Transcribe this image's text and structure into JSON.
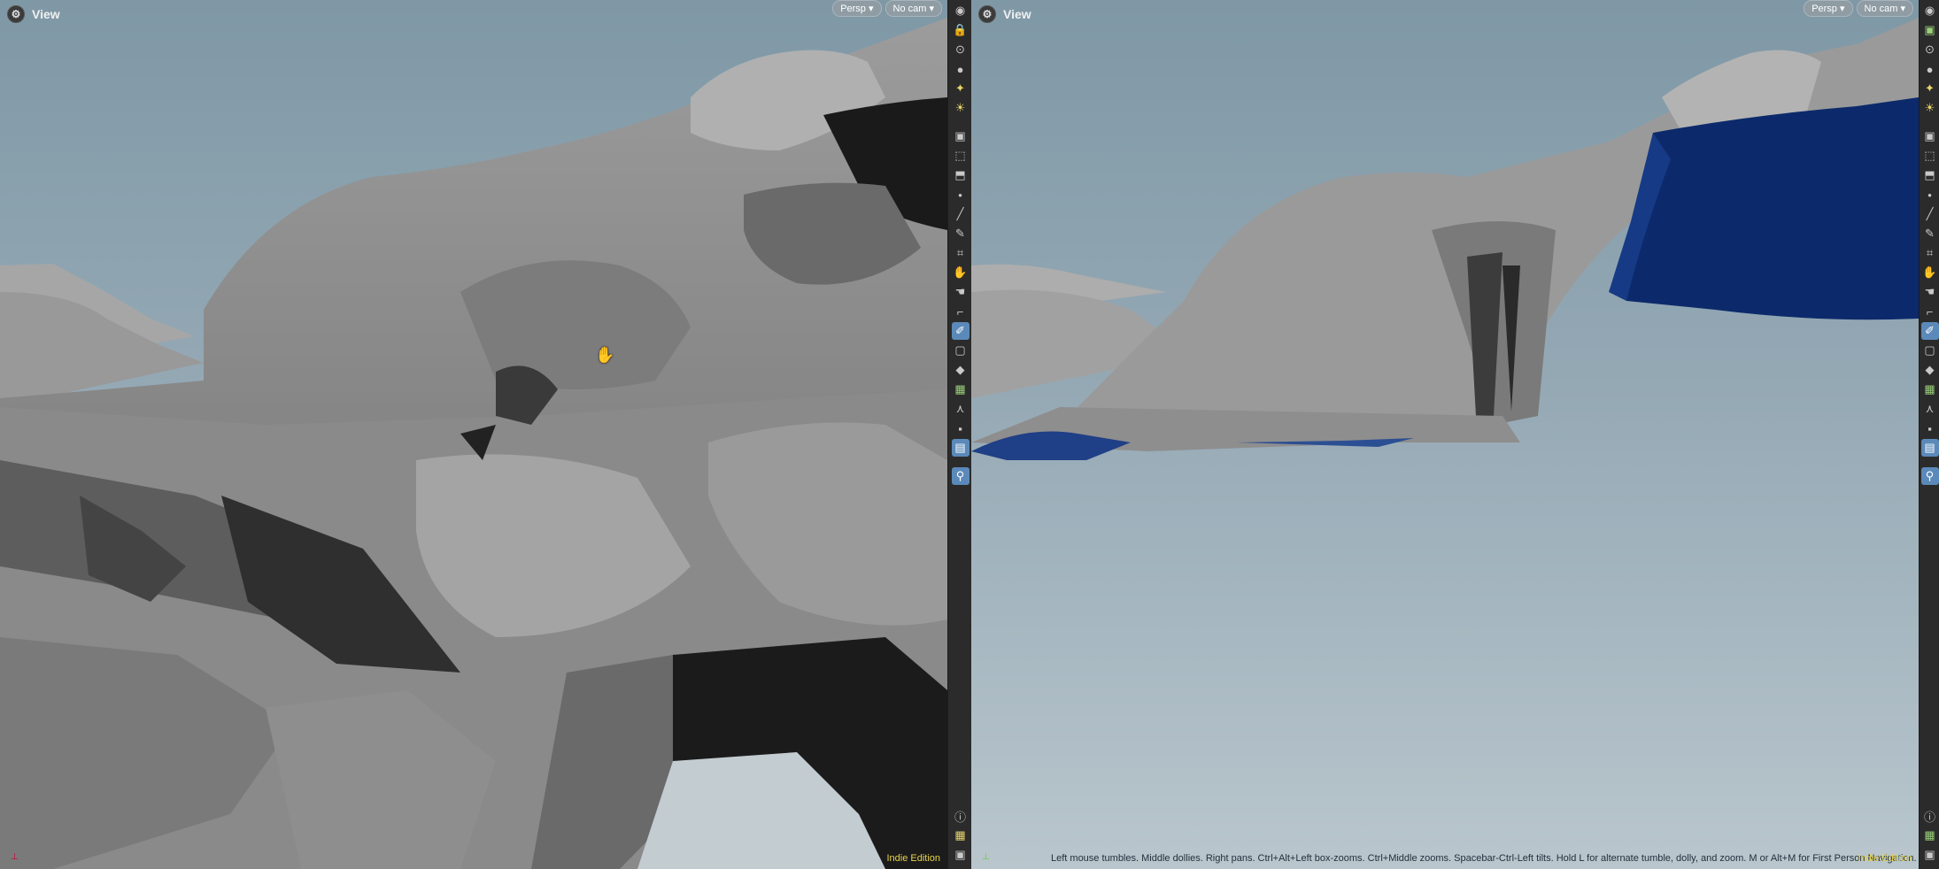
{
  "left_view": {
    "title": "View",
    "camera_menu": "Persp",
    "cam_menu": "No cam",
    "edition": "Indie Edition"
  },
  "right_view": {
    "title": "View",
    "camera_menu": "Persp",
    "cam_menu": "No cam",
    "edition": "Indie Edition",
    "hint": "Left mouse tumbles. Middle dollies. Right pans. Ctrl+Alt+Left box-zooms. Ctrl+Middle zooms. Spacebar-Ctrl-Left tilts. Hold L for alternate tumble, dolly, and zoom. M or Alt+M for First Person Navigation."
  },
  "colors": {
    "sky_top": "#7f98a6",
    "rock": "#8a8a8a",
    "water": "#0c2a6b",
    "edition": "#e8d24a"
  },
  "toolbar_icons": [
    "eye-icon",
    "lock-icon",
    "snap-icon",
    "sphere-icon",
    "light-icon",
    "light-bulb-icon",
    "camera-icon",
    "select-icon",
    "transform-icon",
    "point-icon",
    "edge-icon",
    "brush-icon",
    "tool-icon",
    "tool-icon-2",
    "tool-icon-3",
    "box-select-icon",
    "pen-icon",
    "square-icon",
    "shape-icon",
    "grid-icon",
    "handle-icon",
    "box-icon",
    "display-icon",
    "pin-icon"
  ]
}
